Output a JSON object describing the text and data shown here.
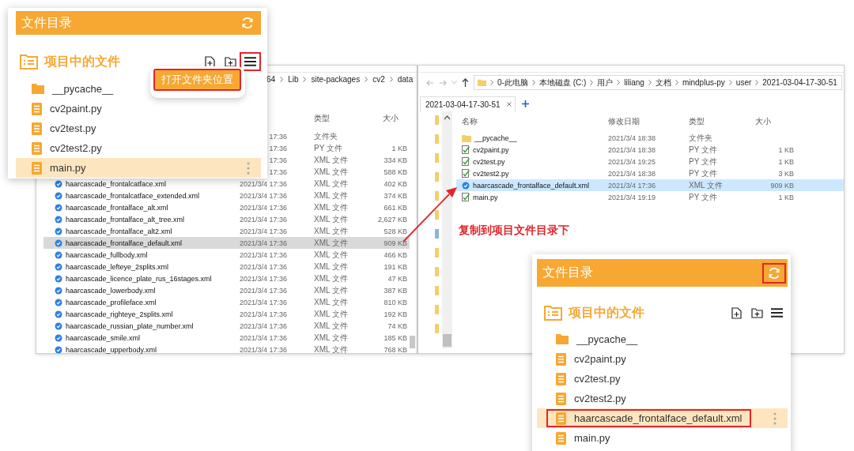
{
  "explorers": [
    {
      "address": [
        "64",
        "Lib",
        "site-packages",
        "cv2",
        "data"
      ],
      "columns": [
        {
          "label": "类型"
        },
        {
          "label": "大小"
        }
      ],
      "rows": [
        {
          "date": "17:36",
          "type": "文件夹",
          "selected": false
        },
        {
          "date": "17:36",
          "type": "PY 文件",
          "size": "1 KB",
          "selected": false
        },
        {
          "date": "17:36",
          "type": "XML 文件",
          "size": "334 KB",
          "selected": false
        },
        {
          "date": "17:36",
          "type": "XML 文件",
          "size": "588 KB",
          "selected": false
        },
        {
          "name": "haarcascade_frontalcatface.xml",
          "kind": "xml",
          "date": "2021/3/4 17:36",
          "type": "XML 文件",
          "size": "402 KB",
          "selected": false
        },
        {
          "name": "haarcascade_frontalcatface_extended.xml",
          "kind": "xml",
          "date": "2021/3/4 17:36",
          "type": "XML 文件",
          "size": "374 KB",
          "selected": false
        },
        {
          "name": "haarcascade_frontalface_alt.xml",
          "kind": "xml",
          "date": "2021/3/4 17:36",
          "type": "XML 文件",
          "size": "661 KB",
          "selected": false
        },
        {
          "name": "haarcascade_frontalface_alt_tree.xml",
          "kind": "xml",
          "date": "2021/3/4 17:36",
          "type": "XML 文件",
          "size": "2,627 KB",
          "selected": false
        },
        {
          "name": "haarcascade_frontalface_alt2.xml",
          "kind": "xml",
          "date": "2021/3/4 17:36",
          "type": "XML 文件",
          "size": "528 KB",
          "selected": false
        },
        {
          "name": "haarcascade_frontalface_default.xml",
          "kind": "xml",
          "date": "2021/3/4 17:36",
          "type": "XML 文件",
          "size": "909 KB",
          "selected": true
        },
        {
          "name": "haarcascade_fullbody.xml",
          "kind": "xml",
          "date": "2021/3/4 17:36",
          "type": "XML 文件",
          "size": "466 KB",
          "selected": false
        },
        {
          "name": "haarcascade_lefteye_2splits.xml",
          "kind": "xml",
          "date": "2021/3/4 17:36",
          "type": "XML 文件",
          "size": "191 KB",
          "selected": false
        },
        {
          "name": "haarcascade_licence_plate_rus_16stages.xml",
          "kind": "xml",
          "date": "2021/3/4 17:36",
          "type": "XML 文件",
          "size": "47 KB",
          "selected": false
        },
        {
          "name": "haarcascade_lowerbody.xml",
          "kind": "xml",
          "date": "2021/3/4 17:36",
          "type": "XML 文件",
          "size": "387 KB",
          "selected": false
        },
        {
          "name": "haarcascade_profileface.xml",
          "kind": "xml",
          "date": "2021/3/4 17:36",
          "type": "XML 文件",
          "size": "810 KB",
          "selected": false
        },
        {
          "name": "haarcascade_righteye_2splits.xml",
          "kind": "xml",
          "date": "2021/3/4 17:36",
          "type": "XML 文件",
          "size": "192 KB",
          "selected": false
        },
        {
          "name": "haarcascade_russian_plate_number.xml",
          "kind": "xml",
          "date": "2021/3/4 17:36",
          "type": "XML 文件",
          "size": "74 KB",
          "selected": false
        },
        {
          "name": "haarcascade_smile.xml",
          "kind": "xml",
          "date": "2021/3/4 17:36",
          "type": "XML 文件",
          "size": "185 KB",
          "selected": false
        },
        {
          "name": "haarcascade_upperbody.xml",
          "kind": "xml",
          "date": "2021/3/4 17:36",
          "type": "XML 文件",
          "size": "768 KB",
          "selected": false
        }
      ]
    },
    {
      "address": [
        "0-此电脑",
        "本地磁盘 (C:)",
        "用户",
        "liliang",
        "文档",
        "mindplus-py",
        "user",
        "2021-03-04-17-30-51"
      ],
      "tab_label": "2021-03-04-17-30-51",
      "columns": [
        {
          "label": "名称"
        },
        {
          "label": "修改日期"
        },
        {
          "label": "类型"
        },
        {
          "label": "大小"
        }
      ],
      "rows": [
        {
          "name": "__pycache__",
          "kind": "folder",
          "date": "2021/3/4 18:38",
          "type": "文件夹",
          "selected": false
        },
        {
          "name": "cv2paint.py",
          "kind": "py",
          "date": "2021/3/4 18:38",
          "type": "PY 文件",
          "size": "1 KB",
          "selected": false
        },
        {
          "name": "cv2test.py",
          "kind": "py",
          "date": "2021/3/4 19:25",
          "type": "PY 文件",
          "size": "1 KB",
          "selected": false
        },
        {
          "name": "cv2test2.py",
          "kind": "py",
          "date": "2021/3/4 18:38",
          "type": "PY 文件",
          "size": "3 KB",
          "selected": false
        },
        {
          "name": "haarcascade_frontalface_default.xml",
          "kind": "xml",
          "date": "2021/3/4 17:36",
          "type": "XML 文件",
          "size": "909 KB",
          "selected": true
        },
        {
          "name": "main.py",
          "kind": "py",
          "date": "2021/3/4 19:19",
          "type": "PY 文件",
          "size": "1 KB",
          "selected": false
        }
      ]
    }
  ],
  "annotation": {
    "text": "复制到项目文件目录下"
  },
  "panels": [
    {
      "title": "文件目录",
      "refresh_button": {
        "highlighted": false
      },
      "section_title": "项目中的文件",
      "menu_button": {
        "highlighted": true
      },
      "context_menu": {
        "label": "打开文件夹位置",
        "highlighted": true
      },
      "items": [
        {
          "name": "__pycache__",
          "kind": "folder",
          "selected": false,
          "highlighted": false
        },
        {
          "name": "cv2paint.py",
          "kind": "file",
          "selected": false,
          "highlighted": false
        },
        {
          "name": "cv2test.py",
          "kind": "file",
          "selected": false,
          "highlighted": false
        },
        {
          "name": "cv2test2.py",
          "kind": "file",
          "selected": false,
          "highlighted": false
        },
        {
          "name": "main.py",
          "kind": "file",
          "selected": true,
          "highlighted": false
        }
      ]
    },
    {
      "title": "文件目录",
      "refresh_button": {
        "highlighted": true
      },
      "section_title": "项目中的文件",
      "menu_button": {
        "highlighted": false
      },
      "items": [
        {
          "name": "__pycache__",
          "kind": "folder",
          "selected": false,
          "highlighted": false
        },
        {
          "name": "cv2paint.py",
          "kind": "file",
          "selected": false,
          "highlighted": false
        },
        {
          "name": "cv2test.py",
          "kind": "file",
          "selected": false,
          "highlighted": false
        },
        {
          "name": "cv2test2.py",
          "kind": "file",
          "selected": false,
          "highlighted": false
        },
        {
          "name": "haarcascade_frontalface_default.xml",
          "kind": "file",
          "selected": true,
          "highlighted": true
        },
        {
          "name": "main.py",
          "kind": "file",
          "selected": false,
          "highlighted": false
        }
      ]
    }
  ]
}
